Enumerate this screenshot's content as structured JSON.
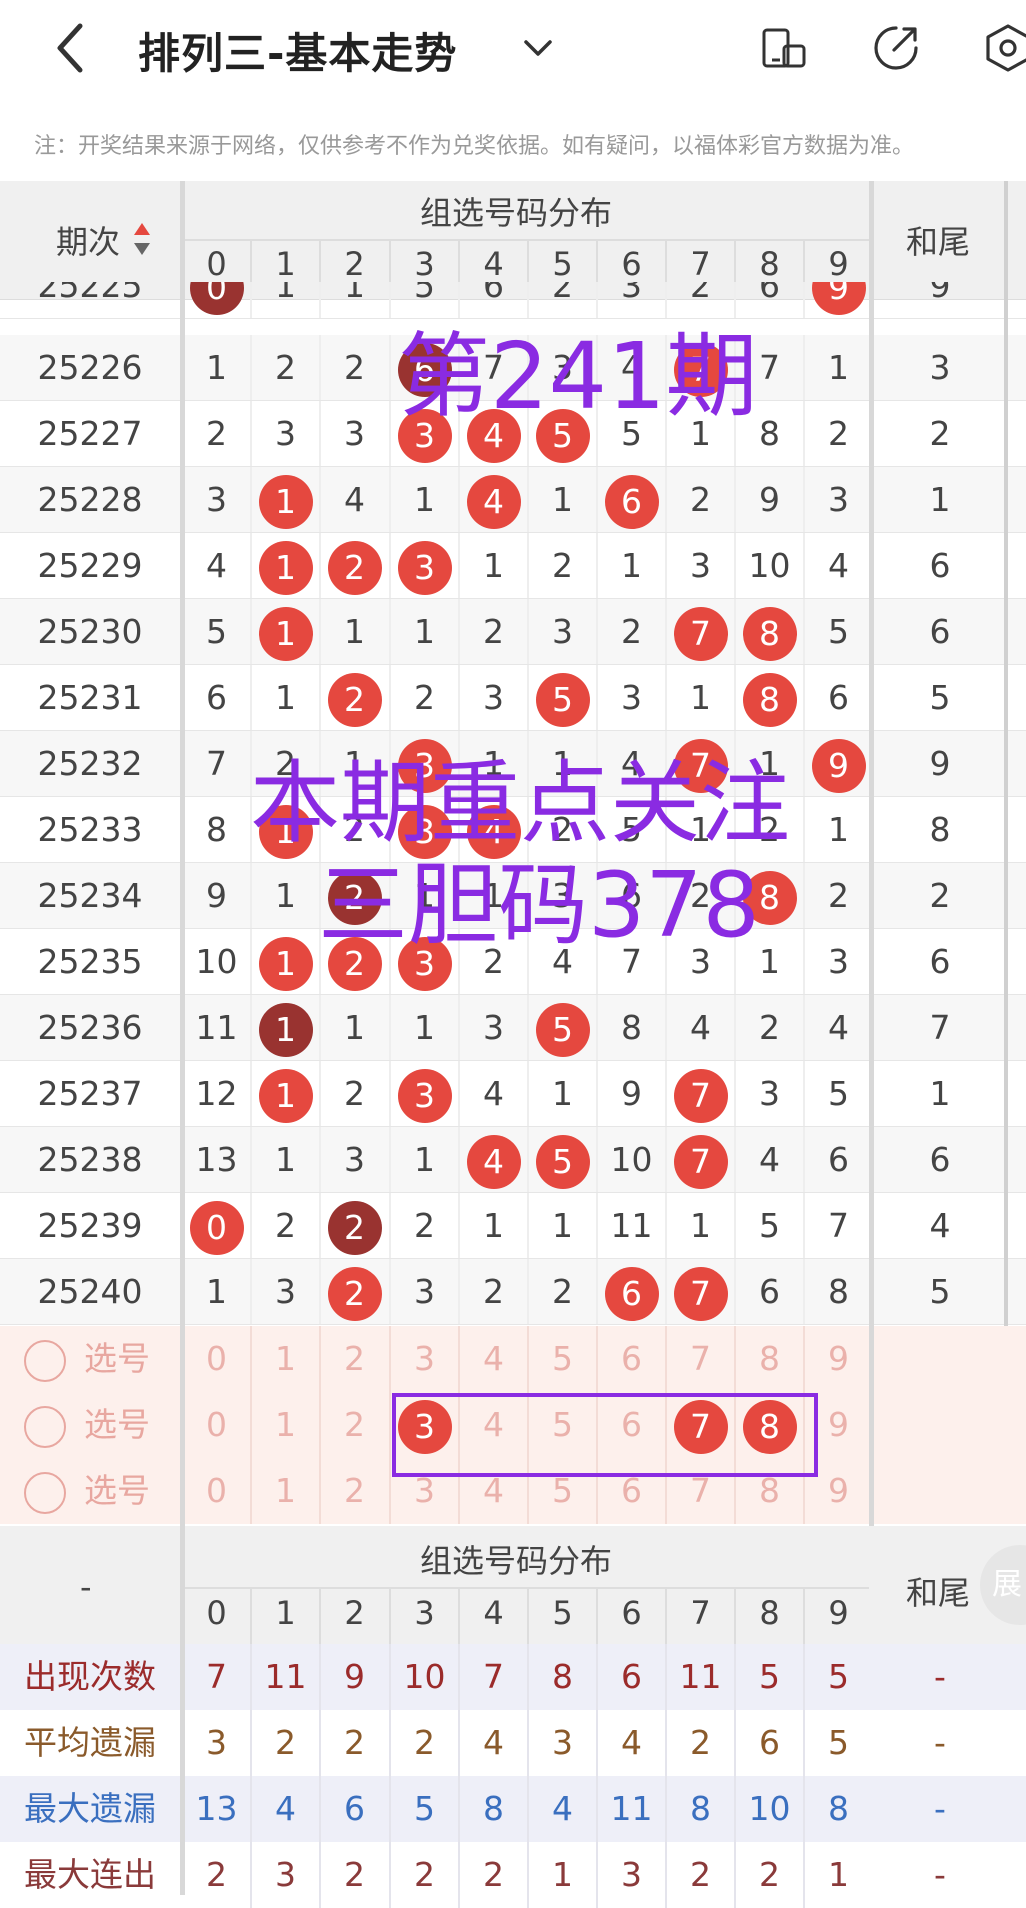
{
  "header": {
    "title": "排列三-基本走势",
    "note": "注：开奖结果来源于网络，仅供参考不作为兑奖依据。如有疑问，以福体彩官方数据为准。"
  },
  "table_header": {
    "period": "期次",
    "group": "组选号码分布",
    "tail": "和尾",
    "digits": [
      "0",
      "1",
      "2",
      "3",
      "4",
      "5",
      "6",
      "7",
      "8",
      "9"
    ],
    "sort_icon": "sort-updown-icon"
  },
  "rows": [
    {
      "period": "25225",
      "cells": [
        {
          "v": "0",
          "s": "dark"
        },
        {
          "v": "1"
        },
        {
          "v": "1"
        },
        {
          "v": "5"
        },
        {
          "v": "6"
        },
        {
          "v": "2"
        },
        {
          "v": "3"
        },
        {
          "v": "2"
        },
        {
          "v": "6"
        },
        {
          "v": "9",
          "s": "red"
        }
      ],
      "tail": "9"
    },
    {
      "period": "25226",
      "cells": [
        {
          "v": "1"
        },
        {
          "v": "2"
        },
        {
          "v": "2"
        },
        {
          "v": "6",
          "s": "dark"
        },
        {
          "v": "7"
        },
        {
          "v": "3"
        },
        {
          "v": "4"
        },
        {
          "v": "7",
          "s": "red"
        },
        {
          "v": "7"
        },
        {
          "v": "1"
        }
      ],
      "tail": "3"
    },
    {
      "period": "25227",
      "cells": [
        {
          "v": "2"
        },
        {
          "v": "3"
        },
        {
          "v": "3"
        },
        {
          "v": "3",
          "s": "red"
        },
        {
          "v": "4",
          "s": "red"
        },
        {
          "v": "5",
          "s": "red"
        },
        {
          "v": "5"
        },
        {
          "v": "1"
        },
        {
          "v": "8"
        },
        {
          "v": "2"
        }
      ],
      "tail": "2"
    },
    {
      "period": "25228",
      "cells": [
        {
          "v": "3"
        },
        {
          "v": "1",
          "s": "red"
        },
        {
          "v": "4"
        },
        {
          "v": "1"
        },
        {
          "v": "4",
          "s": "red"
        },
        {
          "v": "1"
        },
        {
          "v": "6",
          "s": "red"
        },
        {
          "v": "2"
        },
        {
          "v": "9"
        },
        {
          "v": "3"
        }
      ],
      "tail": "1"
    },
    {
      "period": "25229",
      "cells": [
        {
          "v": "4"
        },
        {
          "v": "1",
          "s": "red"
        },
        {
          "v": "2",
          "s": "red"
        },
        {
          "v": "3",
          "s": "red"
        },
        {
          "v": "1"
        },
        {
          "v": "2"
        },
        {
          "v": "1"
        },
        {
          "v": "3"
        },
        {
          "v": "10"
        },
        {
          "v": "4"
        }
      ],
      "tail": "6"
    },
    {
      "period": "25230",
      "cells": [
        {
          "v": "5"
        },
        {
          "v": "1",
          "s": "red"
        },
        {
          "v": "1"
        },
        {
          "v": "1"
        },
        {
          "v": "2"
        },
        {
          "v": "3"
        },
        {
          "v": "2"
        },
        {
          "v": "7",
          "s": "red"
        },
        {
          "v": "8",
          "s": "red"
        },
        {
          "v": "5"
        }
      ],
      "tail": "6"
    },
    {
      "period": "25231",
      "cells": [
        {
          "v": "6"
        },
        {
          "v": "1"
        },
        {
          "v": "2",
          "s": "red"
        },
        {
          "v": "2"
        },
        {
          "v": "3"
        },
        {
          "v": "5",
          "s": "red"
        },
        {
          "v": "3"
        },
        {
          "v": "1"
        },
        {
          "v": "8",
          "s": "red"
        },
        {
          "v": "6"
        }
      ],
      "tail": "5"
    },
    {
      "period": "25232",
      "cells": [
        {
          "v": "7"
        },
        {
          "v": "2"
        },
        {
          "v": "1"
        },
        {
          "v": "3",
          "s": "red"
        },
        {
          "v": "1"
        },
        {
          "v": "1"
        },
        {
          "v": "4"
        },
        {
          "v": "7",
          "s": "red"
        },
        {
          "v": "1"
        },
        {
          "v": "9",
          "s": "red"
        }
      ],
      "tail": "9"
    },
    {
      "period": "25233",
      "cells": [
        {
          "v": "8"
        },
        {
          "v": "1",
          "s": "red"
        },
        {
          "v": "2"
        },
        {
          "v": "3",
          "s": "red"
        },
        {
          "v": "4",
          "s": "red"
        },
        {
          "v": "2"
        },
        {
          "v": "5"
        },
        {
          "v": "1"
        },
        {
          "v": "2"
        },
        {
          "v": "1"
        }
      ],
      "tail": "8"
    },
    {
      "period": "25234",
      "cells": [
        {
          "v": "9"
        },
        {
          "v": "1"
        },
        {
          "v": "2",
          "s": "dark"
        },
        {
          "v": "1"
        },
        {
          "v": "1"
        },
        {
          "v": "3"
        },
        {
          "v": "6"
        },
        {
          "v": "2"
        },
        {
          "v": "8",
          "s": "red"
        },
        {
          "v": "2"
        }
      ],
      "tail": "2"
    },
    {
      "period": "25235",
      "cells": [
        {
          "v": "10"
        },
        {
          "v": "1",
          "s": "red"
        },
        {
          "v": "2",
          "s": "red"
        },
        {
          "v": "3",
          "s": "red"
        },
        {
          "v": "2"
        },
        {
          "v": "4"
        },
        {
          "v": "7"
        },
        {
          "v": "3"
        },
        {
          "v": "1"
        },
        {
          "v": "3"
        }
      ],
      "tail": "6"
    },
    {
      "period": "25236",
      "cells": [
        {
          "v": "11"
        },
        {
          "v": "1",
          "s": "dark"
        },
        {
          "v": "1"
        },
        {
          "v": "1"
        },
        {
          "v": "3"
        },
        {
          "v": "5",
          "s": "red"
        },
        {
          "v": "8"
        },
        {
          "v": "4"
        },
        {
          "v": "2"
        },
        {
          "v": "4"
        }
      ],
      "tail": "7"
    },
    {
      "period": "25237",
      "cells": [
        {
          "v": "12"
        },
        {
          "v": "1",
          "s": "red"
        },
        {
          "v": "2"
        },
        {
          "v": "3",
          "s": "red"
        },
        {
          "v": "4"
        },
        {
          "v": "1"
        },
        {
          "v": "9"
        },
        {
          "v": "7",
          "s": "red"
        },
        {
          "v": "3"
        },
        {
          "v": "5"
        }
      ],
      "tail": "1"
    },
    {
      "period": "25238",
      "cells": [
        {
          "v": "13"
        },
        {
          "v": "1"
        },
        {
          "v": "3"
        },
        {
          "v": "1"
        },
        {
          "v": "4",
          "s": "red"
        },
        {
          "v": "5",
          "s": "red"
        },
        {
          "v": "10"
        },
        {
          "v": "7",
          "s": "red"
        },
        {
          "v": "4"
        },
        {
          "v": "6"
        }
      ],
      "tail": "6"
    },
    {
      "period": "25239",
      "cells": [
        {
          "v": "0",
          "s": "red"
        },
        {
          "v": "2"
        },
        {
          "v": "2",
          "s": "dark"
        },
        {
          "v": "2"
        },
        {
          "v": "1"
        },
        {
          "v": "1"
        },
        {
          "v": "11"
        },
        {
          "v": "1"
        },
        {
          "v": "5"
        },
        {
          "v": "7"
        }
      ],
      "tail": "4"
    },
    {
      "period": "25240",
      "cells": [
        {
          "v": "1"
        },
        {
          "v": "3"
        },
        {
          "v": "2",
          "s": "red"
        },
        {
          "v": "3"
        },
        {
          "v": "2"
        },
        {
          "v": "2"
        },
        {
          "v": "6",
          "s": "red"
        },
        {
          "v": "7",
          "s": "red"
        },
        {
          "v": "6"
        },
        {
          "v": "8"
        }
      ],
      "tail": "5"
    }
  ],
  "selector_rows": [
    {
      "label": "选号",
      "cells": [
        {
          "v": "0"
        },
        {
          "v": "1"
        },
        {
          "v": "2"
        },
        {
          "v": "3"
        },
        {
          "v": "4"
        },
        {
          "v": "5"
        },
        {
          "v": "6"
        },
        {
          "v": "7"
        },
        {
          "v": "8"
        },
        {
          "v": "9"
        }
      ]
    },
    {
      "label": "选号",
      "cells": [
        {
          "v": "0"
        },
        {
          "v": "1"
        },
        {
          "v": "2"
        },
        {
          "v": "3",
          "s": "red"
        },
        {
          "v": "4"
        },
        {
          "v": "5"
        },
        {
          "v": "6"
        },
        {
          "v": "7",
          "s": "red"
        },
        {
          "v": "8",
          "s": "red"
        },
        {
          "v": "9"
        }
      ]
    },
    {
      "label": "选号",
      "cells": [
        {
          "v": "0"
        },
        {
          "v": "1"
        },
        {
          "v": "2"
        },
        {
          "v": "3"
        },
        {
          "v": "4"
        },
        {
          "v": "5"
        },
        {
          "v": "6"
        },
        {
          "v": "7"
        },
        {
          "v": "8"
        },
        {
          "v": "9"
        }
      ]
    }
  ],
  "footer_header": {
    "period": "-",
    "group": "组选号码分布",
    "tail": "和尾",
    "digits": [
      "0",
      "1",
      "2",
      "3",
      "4",
      "5",
      "6",
      "7",
      "8",
      "9"
    ],
    "expand_label": "展"
  },
  "stats": [
    {
      "label": "出现次数",
      "color": "#9b2b2b",
      "values": [
        "7",
        "11",
        "9",
        "10",
        "7",
        "8",
        "6",
        "11",
        "5",
        "5"
      ],
      "tail": "-"
    },
    {
      "label": "平均遗漏",
      "color": "#8a5a2b",
      "values": [
        "3",
        "2",
        "2",
        "2",
        "4",
        "3",
        "4",
        "2",
        "6",
        "5"
      ],
      "tail": "-"
    },
    {
      "label": "最大遗漏",
      "color": "#3a6fbf",
      "values": [
        "13",
        "4",
        "6",
        "5",
        "8",
        "4",
        "11",
        "8",
        "10",
        "8"
      ],
      "tail": "-"
    },
    {
      "label": "最大连出",
      "color": "#8a3a3a",
      "values": [
        "2",
        "3",
        "2",
        "2",
        "2",
        "1",
        "3",
        "2",
        "2",
        "1"
      ],
      "tail": "-"
    }
  ],
  "overlay": {
    "line1": "第241期",
    "line2": "本期重点关注",
    "line3": "三胆码378",
    "color": "#8a2be2"
  },
  "colors": {
    "ball_red": "#e5483f",
    "ball_dark": "#993330",
    "selector_bg": "#fdf0ec"
  }
}
